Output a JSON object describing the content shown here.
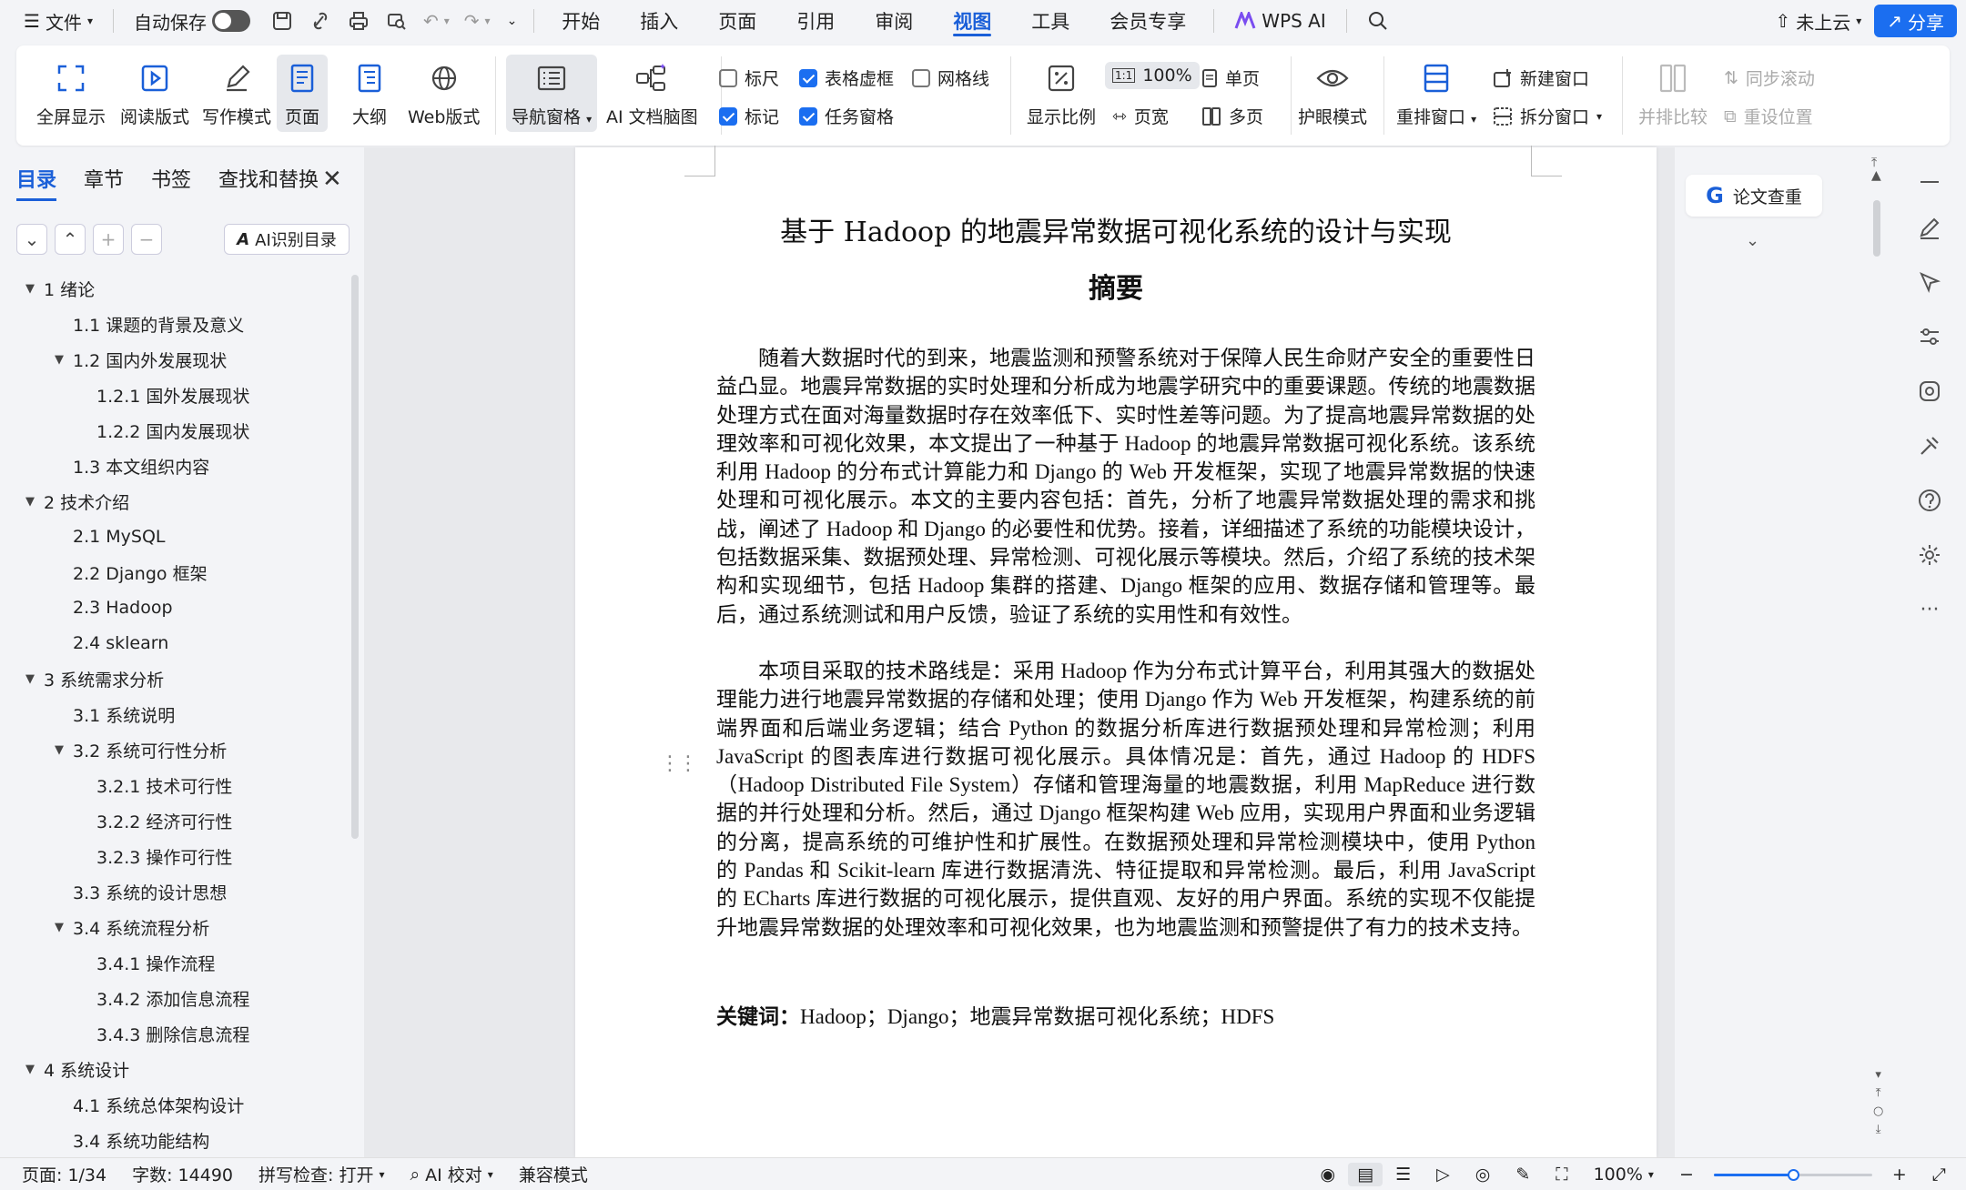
{
  "menubar": {
    "file_label": "文件",
    "autosave_label": "自动保存",
    "tabs": [
      "开始",
      "插入",
      "页面",
      "引用",
      "审阅",
      "视图",
      "工具",
      "会员专享"
    ],
    "active_tab": "视图",
    "wps_ai_label": "WPS AI",
    "cloud_label": "未上云",
    "share_label": "分享"
  },
  "ribbon": {
    "fullscreen": "全屏显示",
    "reading": "阅读版式",
    "writing": "写作模式",
    "page": "页面",
    "outline": "大纲",
    "web": "Web版式",
    "nav_pane": "导航窗格",
    "ai_mindmap": "AI 文档脑图",
    "ruler": "标尺",
    "table_gridlines": "表格虚框",
    "gridlines": "网格线",
    "marks": "标记",
    "task_pane": "任务窗格",
    "zoom_ratio": "显示比例",
    "zoom_100": "100%",
    "page_width": "页宽",
    "single_page": "单页",
    "multi_page": "多页",
    "eye_mode": "护眼模式",
    "arrange_windows": "重排窗口",
    "new_window": "新建窗口",
    "split_window": "拆分窗口",
    "side_by_side": "并排比较",
    "sync_scroll": "同步滚动",
    "reset_position": "重设位置"
  },
  "leftnav": {
    "tabs": [
      "目录",
      "章节",
      "书签",
      "查找和替换"
    ],
    "active_tab": "目录",
    "ai_toc_label": "AI识别目录",
    "toc": [
      {
        "label": "1  绪论",
        "level": 1,
        "arrow": "▼"
      },
      {
        "label": "1.1  课题的背景及意义",
        "level": 2,
        "arrow": ""
      },
      {
        "label": "1.2  国内外发展现状",
        "level": 2,
        "arrow": "▼"
      },
      {
        "label": "1.2.1  国外发展现状",
        "level": 3,
        "arrow": ""
      },
      {
        "label": "1.2.2  国内发展现状",
        "level": 3,
        "arrow": ""
      },
      {
        "label": "1.3  本文组织内容",
        "level": 2,
        "arrow": ""
      },
      {
        "label": "2  技术介绍",
        "level": 1,
        "arrow": "▼"
      },
      {
        "label": "2.1 MySQL",
        "level": 2,
        "arrow": ""
      },
      {
        "label": "2.2 Django 框架",
        "level": 2,
        "arrow": ""
      },
      {
        "label": "2.3 Hadoop",
        "level": 2,
        "arrow": ""
      },
      {
        "label": "2.4 sklearn",
        "level": 2,
        "arrow": ""
      },
      {
        "label": "3 系统需求分析",
        "level": 1,
        "arrow": "▼"
      },
      {
        "label": "3.1 系统说明",
        "level": 2,
        "arrow": ""
      },
      {
        "label": "3.2 系统可行性分析",
        "level": 2,
        "arrow": "▼"
      },
      {
        "label": "3.2.1 技术可行性",
        "level": 3,
        "arrow": ""
      },
      {
        "label": "3.2.2 经济可行性",
        "level": 3,
        "arrow": ""
      },
      {
        "label": "3.2.3 操作可行性",
        "level": 3,
        "arrow": ""
      },
      {
        "label": "3.3 系统的设计思想",
        "level": 2,
        "arrow": ""
      },
      {
        "label": "3.4 系统流程分析",
        "level": 2,
        "arrow": "▼"
      },
      {
        "label": "3.4.1 操作流程",
        "level": 3,
        "arrow": ""
      },
      {
        "label": "3.4.2 添加信息流程",
        "level": 3,
        "arrow": ""
      },
      {
        "label": "3.4.3 删除信息流程",
        "level": 3,
        "arrow": ""
      },
      {
        "label": "4 系统设计",
        "level": 1,
        "arrow": "▼"
      },
      {
        "label": "4.1  系统总体架构设计",
        "level": 2,
        "arrow": ""
      },
      {
        "label": "3.4 系统功能结构",
        "level": 2,
        "arrow": ""
      }
    ]
  },
  "document": {
    "title": "基于 Hadoop 的地震异常数据可视化系统的设计与实现",
    "abstract_heading": "摘要",
    "para1": "随着大数据时代的到来，地震监测和预警系统对于保障人民生命财产安全的重要性日益凸显。地震异常数据的实时处理和分析成为地震学研究中的重要课题。传统的地震数据处理方式在面对海量数据时存在效率低下、实时性差等问题。为了提高地震异常数据的处理效率和可视化效果，本文提出了一种基于 Hadoop 的地震异常数据可视化系统。该系统利用 Hadoop 的分布式计算能力和 Django 的 Web 开发框架，实现了地震异常数据的快速处理和可视化展示。本文的主要内容包括：首先，分析了地震异常数据处理的需求和挑战，阐述了 Hadoop 和 Django 的必要性和优势。接着，详细描述了系统的功能模块设计，包括数据采集、数据预处理、异常检测、可视化展示等模块。然后，介绍了系统的技术架构和实现细节，包括 Hadoop 集群的搭建、Django 框架的应用、数据存储和管理等。最后，通过系统测试和用户反馈，验证了系统的实用性和有效性。",
    "para2": "本项目采取的技术路线是：采用 Hadoop 作为分布式计算平台，利用其强大的数据处理能力进行地震异常数据的存储和处理；使用 Django 作为 Web 开发框架，构建系统的前端界面和后端业务逻辑；结合 Python 的数据分析库进行数据预处理和异常检测；利用 JavaScript 的图表库进行数据可视化展示。具体情况是：首先，通过 Hadoop 的 HDFS（Hadoop Distributed File System）存储和管理海量的地震数据，利用 MapReduce 进行数据的并行处理和分析。然后，通过 Django 框架构建 Web 应用，实现用户界面和业务逻辑的分离，提高系统的可维护性和扩展性。在数据预处理和异常检测模块中，使用 Python 的 Pandas 和 Scikit-learn 库进行数据清洗、特征提取和异常检测。最后，利用 JavaScript 的 ECharts 库进行数据的可视化展示，提供直观、友好的用户界面。系统的实现不仅能提升地震异常数据的处理效率和可视化效果，也为地震监测和预警提供了有力的技术支持。",
    "keywords_label": "关键词：",
    "keywords": "Hadoop；Django；地震异常数据可视化系统；HDFS"
  },
  "rightpanel": {
    "essay_check_label": "论文查重"
  },
  "statusbar": {
    "page": "页面: 1/34",
    "words": "字数: 14490",
    "spellcheck": "拼写检查: 打开",
    "ai_proof": "AI 校对",
    "compat": "兼容模式",
    "zoom": "100%",
    "zoom_level": 0.5
  },
  "colors": {
    "accent": "#1a5fd8",
    "share_button": "#1b6ef0"
  }
}
